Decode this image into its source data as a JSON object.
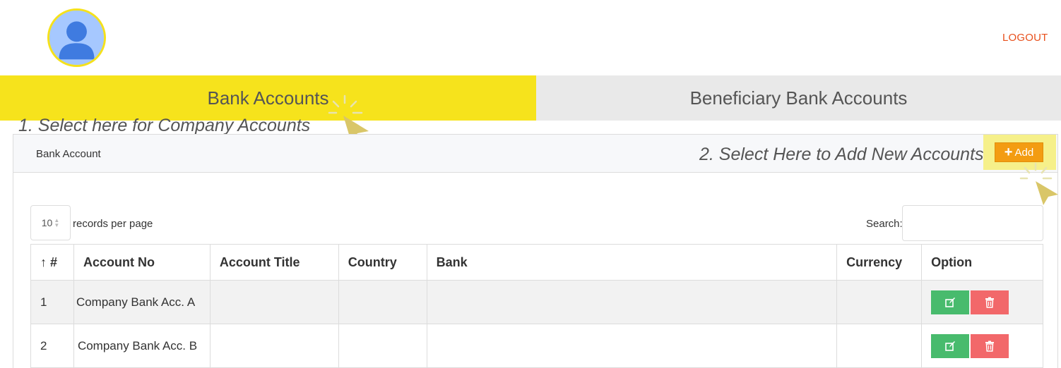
{
  "header": {
    "logout_label": "LOGOUT"
  },
  "tabs": [
    {
      "label": "Bank Accounts",
      "active": true
    },
    {
      "label": "Beneficiary Bank Accounts",
      "active": false
    }
  ],
  "hints": {
    "step1": "1. Select here for Company Accounts",
    "step2": "2. Select Here to Add New Accounts"
  },
  "panel": {
    "title": "Bank Account",
    "add_label": "Add",
    "page_length_value": "10",
    "page_length_label": "records per page",
    "search_label": "Search:",
    "search_value": ""
  },
  "table": {
    "columns": [
      "↑ #",
      "Account No",
      "Account Title",
      "Country",
      "Bank",
      "Currency",
      "Option"
    ],
    "rows": [
      {
        "num": "1",
        "account_no": "Company Bank Acc. A",
        "account_title": "",
        "country": "",
        "bank": "",
        "currency": ""
      },
      {
        "num": "2",
        "account_no": "Company Bank Acc. B",
        "account_title": "",
        "country": "",
        "bank": "",
        "currency": ""
      }
    ]
  },
  "icons": {
    "avatar": "user-avatar-icon",
    "add": "plus-icon",
    "edit": "edit-icon",
    "delete": "trash-icon",
    "pointer": "cursor-pointer-icon"
  },
  "colors": {
    "active_tab": "#f6e31c",
    "inactive_tab": "#e9e9e9",
    "logout": "#e8501c",
    "add_button": "#f39c12",
    "edit_button": "#48bb6d",
    "delete_button": "#f2686a"
  }
}
